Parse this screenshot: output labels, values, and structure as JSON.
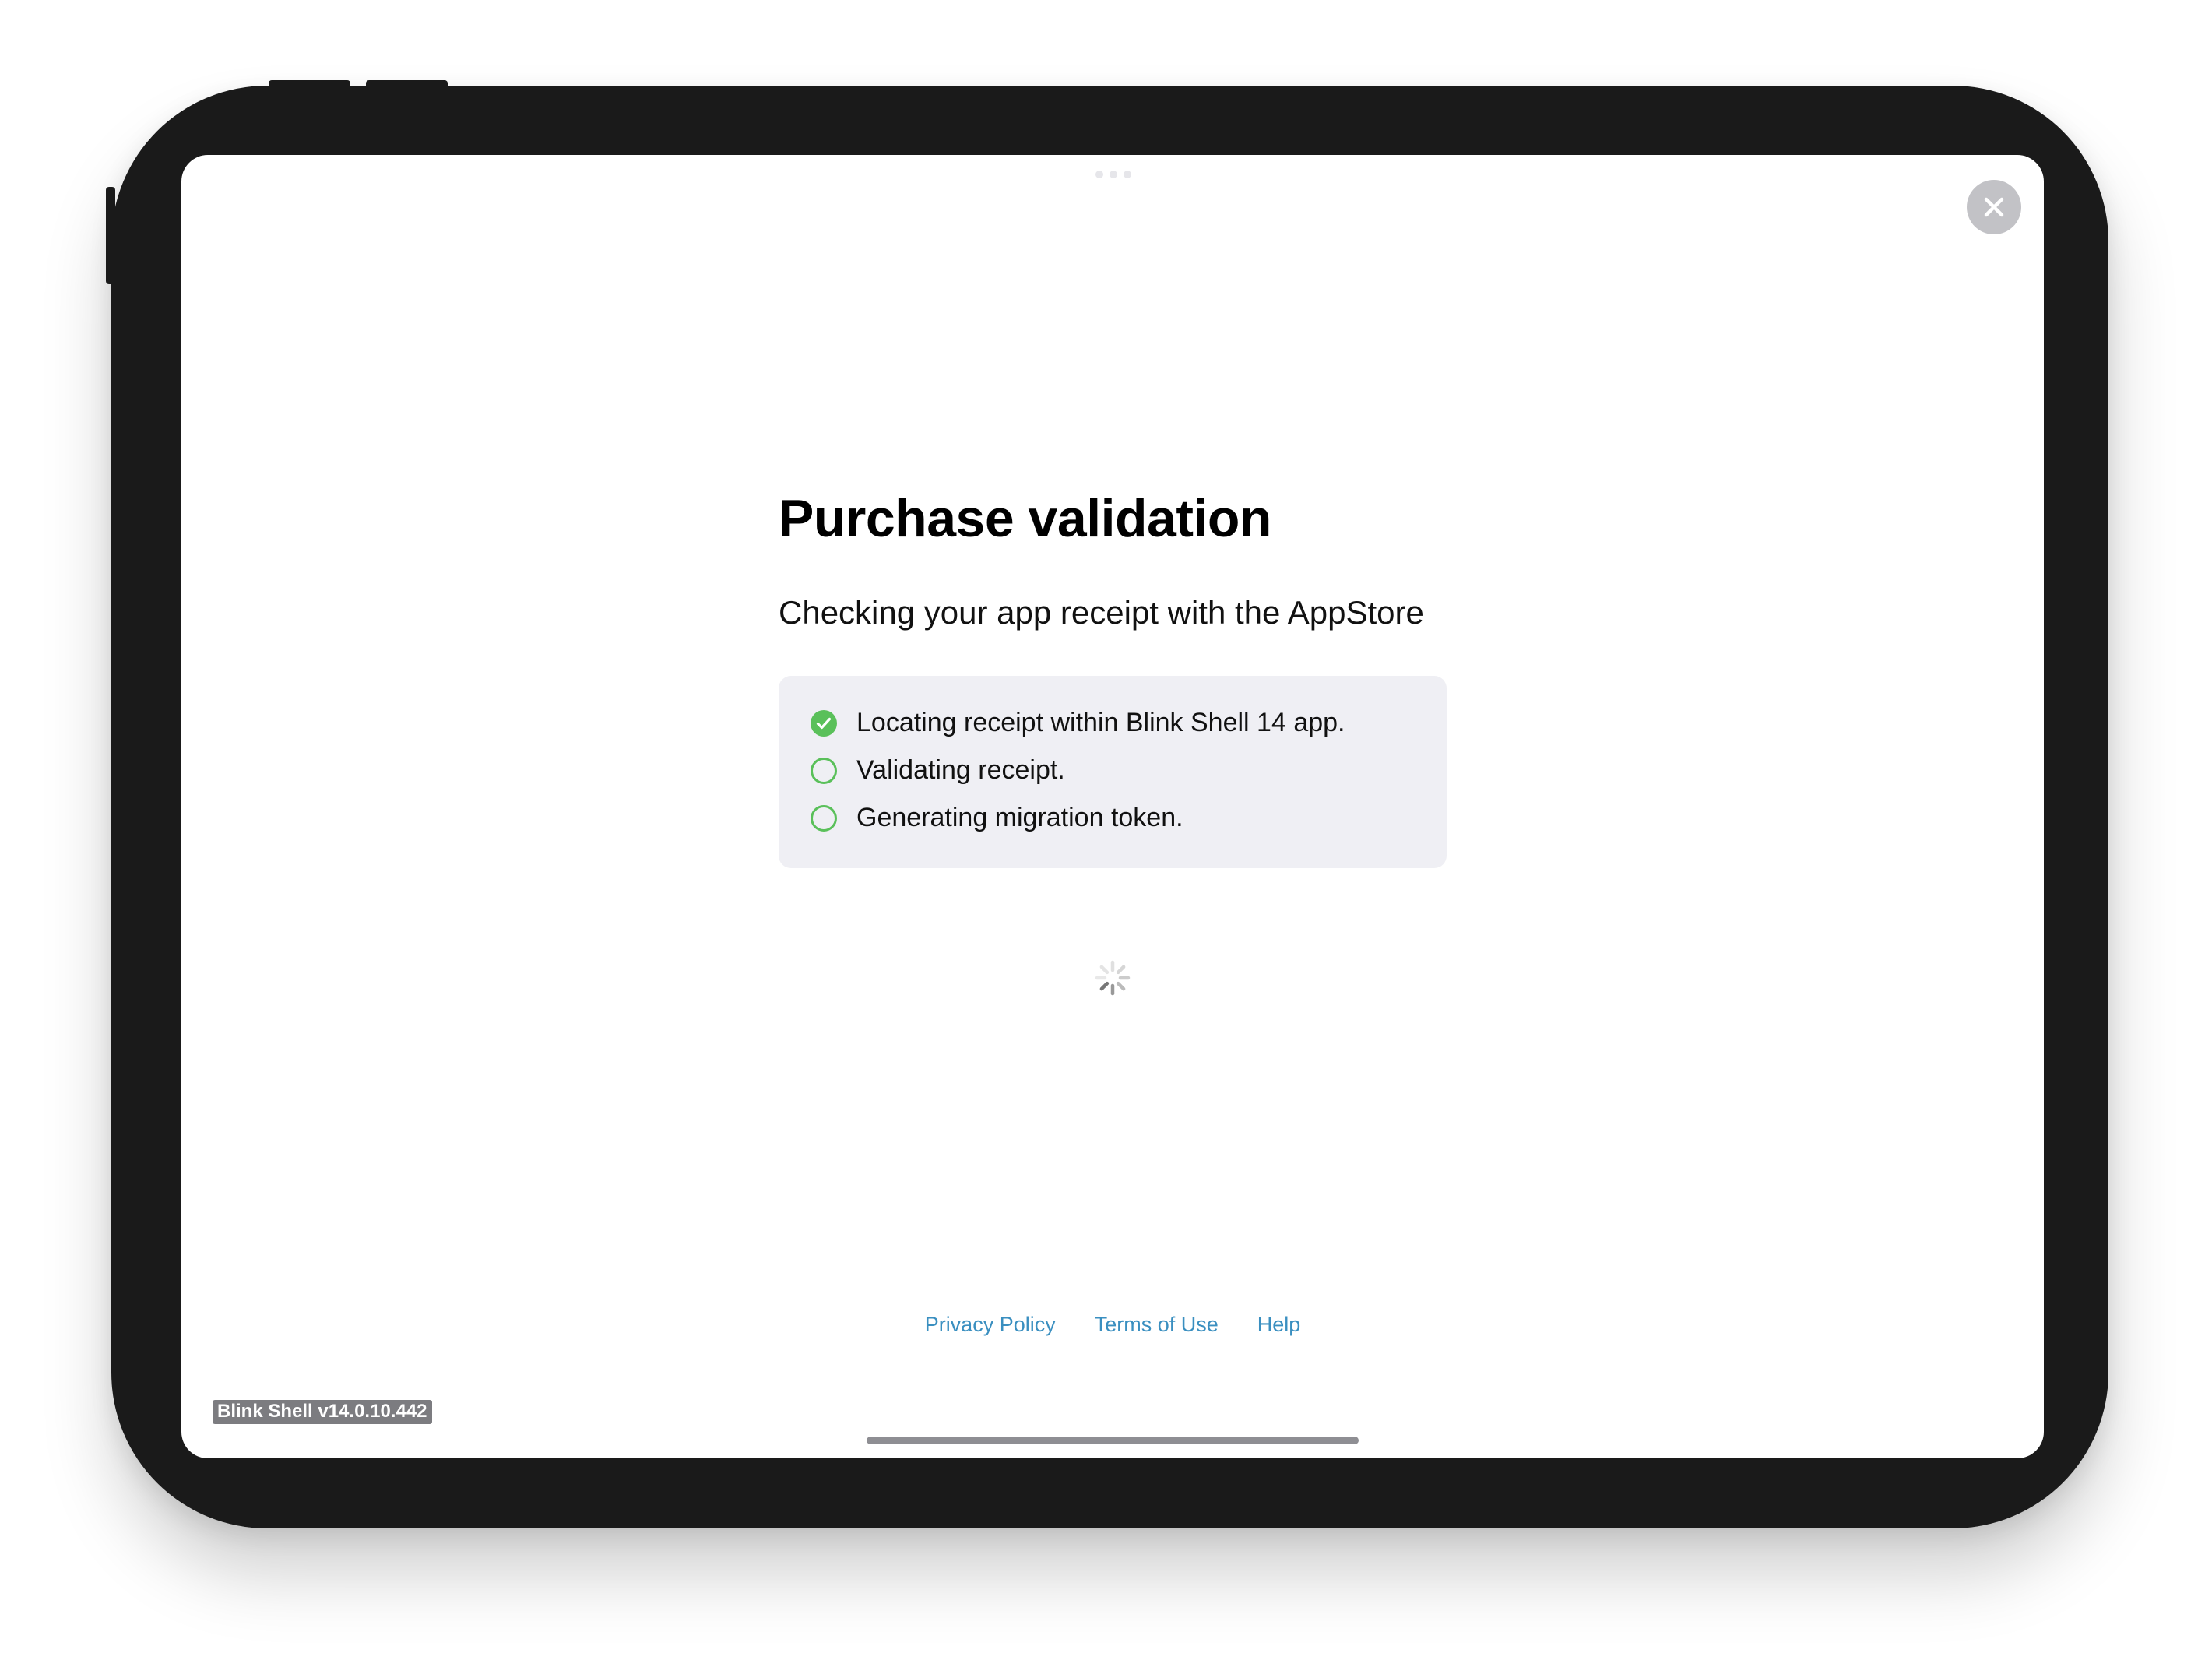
{
  "sheet": {
    "title": "Purchase validation",
    "subtitle": "Checking your app receipt with the AppStore",
    "steps": [
      {
        "label": "Locating receipt within Blink Shell 14 app.",
        "status": "done"
      },
      {
        "label": "Validating receipt.",
        "status": "pending"
      },
      {
        "label": "Generating migration token.",
        "status": "pending"
      }
    ],
    "close_icon": "close-icon",
    "loading_icon": "activity-spinner-icon"
  },
  "footer": {
    "privacy_label": "Privacy Policy",
    "terms_label": "Terms of Use",
    "help_label": "Help"
  },
  "version_label": "Blink Shell v14.0.10.442",
  "colors": {
    "accent_link": "#3a8fc0",
    "step_done": "#5ac05a",
    "step_pending": "#5ac05a",
    "steps_background": "#efeff4",
    "device_frame": "#1a1a1a"
  }
}
